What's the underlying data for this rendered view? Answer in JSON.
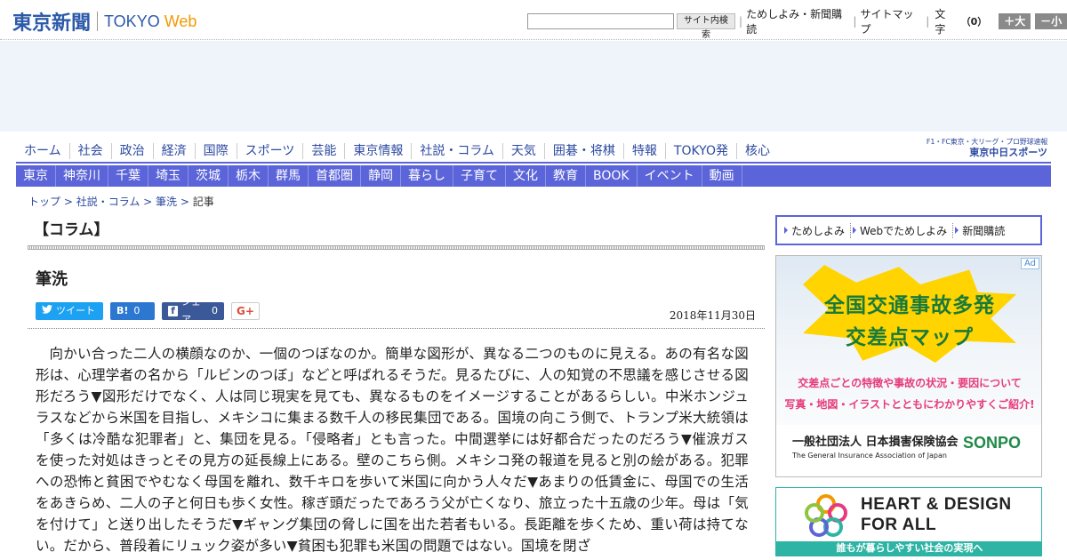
{
  "header": {
    "logo_jp": "東京新聞",
    "logo_tokyo": "TOKYO",
    "logo_web": "Web",
    "search_placeholder": "",
    "search_button": "サイト内検索",
    "link_subscribe": "ためしよみ・新聞購読",
    "link_sitemap": "サイトマップ",
    "moji_label": "文字",
    "moji_count": "（0）",
    "btn_larger": "＋大",
    "btn_smaller": "－小"
  },
  "main_nav": [
    {
      "label": "ホーム"
    },
    {
      "label": "社会"
    },
    {
      "label": "政治"
    },
    {
      "label": "経済"
    },
    {
      "label": "国際"
    },
    {
      "label": "スポーツ"
    },
    {
      "label": "芸能"
    },
    {
      "label": "東京情報"
    },
    {
      "label": "社説・コラム"
    },
    {
      "label": "天気"
    },
    {
      "label": "囲碁・将棋"
    },
    {
      "label": "特報"
    },
    {
      "label": "TOKYO発"
    },
    {
      "label": "核心"
    }
  ],
  "chunichi": {
    "tagline": "F1・FC東京・大リーグ・プロ野球速報",
    "name": "東京中日スポーツ"
  },
  "region_nav": [
    {
      "label": "東京"
    },
    {
      "label": "神奈川"
    },
    {
      "label": "千葉"
    },
    {
      "label": "埼玉"
    },
    {
      "label": "茨城"
    },
    {
      "label": "栃木"
    },
    {
      "label": "群馬"
    },
    {
      "label": "首都圏"
    },
    {
      "label": "静岡"
    },
    {
      "label": "暮らし"
    },
    {
      "label": "子育て"
    },
    {
      "label": "文化"
    },
    {
      "label": "教育"
    },
    {
      "label": "BOOK"
    },
    {
      "label": "イベント"
    },
    {
      "label": "動画"
    }
  ],
  "breadcrumb": {
    "top": "トップ",
    "sep1": " > ",
    "section": "社説・コラム",
    "sep2": " > ",
    "column": "筆洗",
    "sep3": " > ",
    "current": "記事"
  },
  "section_title": "【コラム】",
  "article": {
    "title": "筆洗",
    "date": "2018年11月30日",
    "body": "向かい合った二人の横顔なのか、一個のつぼなのか。簡単な図形が、異なる二つのものに見える。あの有名な図形は、心理学者の名から「ルビンのつぼ」などと呼ばれるそうだ。見るたびに、人の知覚の不思議を感じさせる図形だろう▼図形だけでなく、人は同じ現実を見ても、異なるものをイメージすることがあるらしい。中米ホンジュラスなどから米国を目指し、メキシコに集まる数千人の移民集団である。国境の向こう側で、トランプ米大統領は「多くは冷酷な犯罪者」と、集団を見る。「侵略者」とも言った。中間選挙には好都合だったのだろう▼催涙ガスを使った対処はきっとその見方の延長線上にある。壁のこちら側。メキシコ発の報道を見ると別の絵がある。犯罪への恐怖と貧困でやむなく母国を離れ、数千キロを歩いて米国に向かう人々だ▼あまりの低賃金に、母国での生活をあきらめ、二人の子と何日も歩く女性。稼ぎ頭だったであろう父が亡くなり、旅立った十五歳の少年。母は「気を付けて」と送り出したそうだ▼ギャング集団の脅しに国を出た若者もいる。長距離を歩くため、重い荷は持てない。だから、普段着にリュック姿が多い▼貧困も犯罪も米国の問題ではない。国境を閉ざ"
  },
  "share": {
    "tweet": "ツイート",
    "hatena_icon": "B!",
    "hatena_count": "0",
    "fb_label": "シェア",
    "fb_count": "0",
    "gplus": "G+"
  },
  "sidebar": {
    "links": [
      {
        "label": "ためしよみ"
      },
      {
        "label": "Webでためしよみ"
      },
      {
        "label": "新聞購読"
      }
    ]
  },
  "ad_map": {
    "badge": "Ad",
    "title_line1": "全国交通事故多発",
    "title_line2": "交差点マップ",
    "sub_line1": "交差点ごとの特徴や事故の状況・要因について",
    "sub_line2": "写真・地図・イラストとともにわかりやすくご紹介!",
    "org": "一般社団法人 日本損害保険協会",
    "org_en": "The General Insurance Association of Japan",
    "sonpo": "SONPO"
  },
  "ad_heart": {
    "title_line1": "HEART & DESIGN",
    "title_line2": "FOR ALL",
    "footer": "誰もが暮らしやすい社会の実現へ"
  },
  "colors": {
    "brand_blue": "#2c5aa8",
    "accent_orange": "#f39800",
    "nav_purple": "#5b64d8",
    "teal": "#2eb4a4"
  }
}
